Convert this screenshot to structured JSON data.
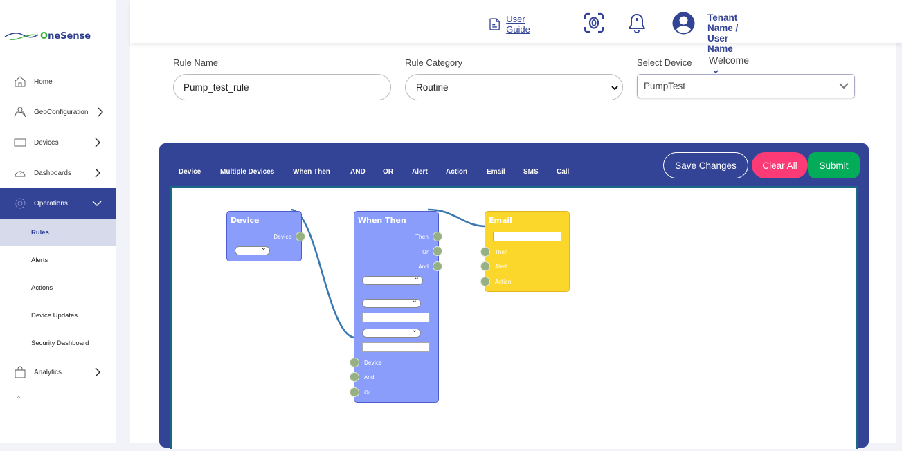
{
  "brand": {
    "name_first": "O",
    "name_rest": "neSense"
  },
  "sidebar": {
    "items": [
      {
        "label": "Home",
        "icon": "home-icon",
        "has_chevron": false
      },
      {
        "label": "GeoConfiguration",
        "icon": "map-pin-icon",
        "has_chevron": true
      },
      {
        "label": "Devices",
        "icon": "monitor-icon",
        "has_chevron": true
      },
      {
        "label": "Dashboards",
        "icon": "speedometer-icon",
        "has_chevron": true
      },
      {
        "label": "Operations",
        "icon": "gear-icon",
        "has_chevron": true,
        "expanded": true,
        "active": true
      },
      {
        "label": "Analytics",
        "icon": "shopping-bag-icon",
        "has_chevron": true
      }
    ],
    "sub_items": [
      {
        "label": "Rules",
        "active": true
      },
      {
        "label": "Alerts"
      },
      {
        "label": "Actions"
      },
      {
        "label": "Device Updates"
      },
      {
        "label": "Security Dashboard"
      }
    ]
  },
  "header": {
    "user_guide": "User Guide",
    "user_name": "Tenant Name / User Name",
    "welcome": "Welcome"
  },
  "form": {
    "rule_name_label": "Rule Name",
    "rule_name_value": "Pump_test_rule",
    "rule_category_label": "Rule Category",
    "rule_category_value": "Routine",
    "select_device_label": "Select Device",
    "select_device_value": "PumpTest"
  },
  "builder": {
    "palette": [
      "Device",
      "Multiple Devices",
      "When Then",
      "AND",
      "OR",
      "Alert",
      "Action",
      "Email",
      "SMS",
      "Call"
    ],
    "save_label": "Save Changes",
    "clear_label": "Clear All",
    "submit_label": "Submit",
    "nodes": {
      "device": {
        "title": "Device",
        "outputs": [
          "Device"
        ]
      },
      "when_then": {
        "title": "When Then",
        "outputs": [
          "Then",
          "Or",
          "And"
        ],
        "inputs": [
          "Device",
          "And",
          "Or"
        ]
      },
      "email": {
        "title": "Email",
        "inputs": [
          "Then",
          "Alert",
          "Action"
        ]
      }
    },
    "connections": [
      {
        "from": "device.Device",
        "to": "when_then.Device"
      },
      {
        "from": "when_then.Then",
        "to": "email.Then"
      }
    ]
  },
  "colors": {
    "primary": "#334395",
    "clear": "#fb3a76",
    "submit": "#02ac58",
    "node_blue": "#8a9dfb",
    "node_yellow": "#fbd72b",
    "wire": "#3b78b0",
    "port": "#97b083"
  }
}
